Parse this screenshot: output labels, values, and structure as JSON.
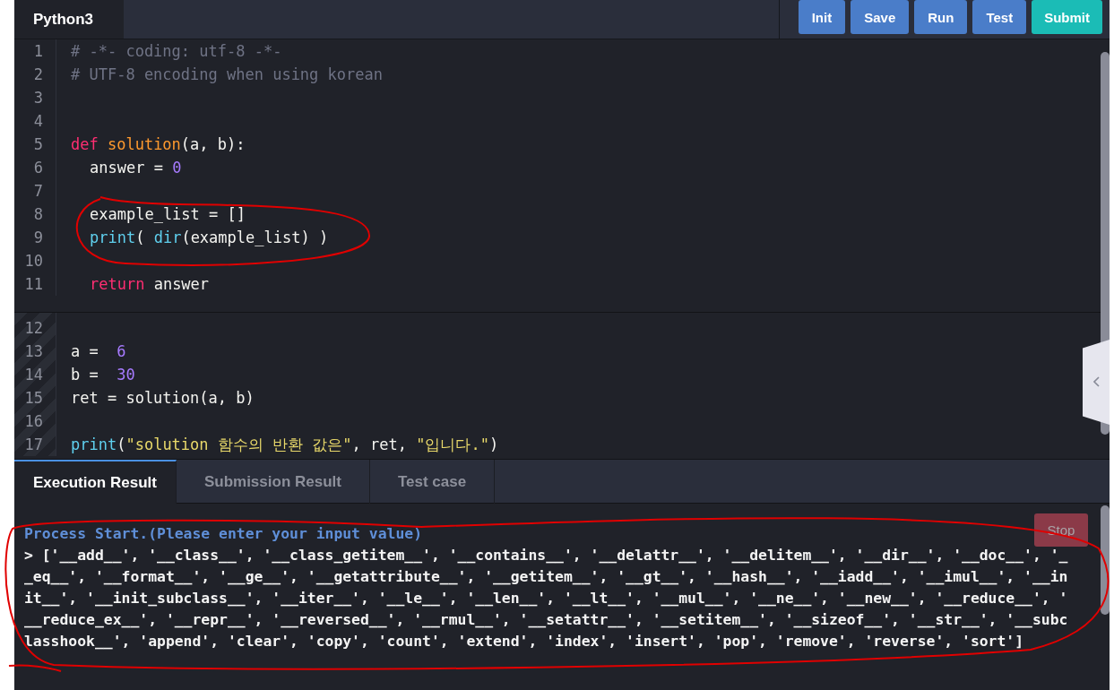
{
  "editor": {
    "language_tab": "Python3",
    "buttons": [
      {
        "label": "Init",
        "kind": "primary"
      },
      {
        "label": "Save",
        "kind": "primary"
      },
      {
        "label": "Run",
        "kind": "primary"
      },
      {
        "label": "Test",
        "kind": "primary"
      },
      {
        "label": "Submit",
        "kind": "accent"
      }
    ],
    "sections": [
      {
        "kind": "editable",
        "lines": [
          {
            "number": "1",
            "indent": false,
            "tokens": [
              {
                "kind": "comment",
                "text": "# -*- coding: utf-8 -*-"
              }
            ]
          },
          {
            "number": "2",
            "indent": false,
            "tokens": [
              {
                "kind": "comment",
                "text": "# UTF-8 encoding when using korean"
              }
            ]
          },
          {
            "number": "3"
          },
          {
            "number": "4"
          },
          {
            "number": "5",
            "indent": false,
            "tokens": [
              {
                "kind": "keyword",
                "text": "def "
              },
              {
                "kind": "function",
                "text": "solution"
              },
              {
                "kind": "plain",
                "text": "(a, b):"
              }
            ]
          },
          {
            "number": "6",
            "indent": true,
            "tokens": [
              {
                "kind": "plain",
                "text": "answer = "
              },
              {
                "kind": "number",
                "text": "0"
              }
            ]
          },
          {
            "number": "7"
          },
          {
            "number": "8",
            "indent": true,
            "tokens": [
              {
                "kind": "plain",
                "text": "example_list = []"
              }
            ]
          },
          {
            "number": "9",
            "indent": true,
            "tokens": [
              {
                "kind": "builtin",
                "text": "print"
              },
              {
                "kind": "plain",
                "text": "( "
              },
              {
                "kind": "builtin",
                "text": "dir"
              },
              {
                "kind": "plain",
                "text": "(example_list) )"
              }
            ]
          },
          {
            "number": "10"
          },
          {
            "number": "11",
            "indent": true,
            "tokens": [
              {
                "kind": "keyword",
                "text": "return"
              },
              {
                "kind": "plain",
                "text": " answer"
              }
            ]
          }
        ]
      },
      {
        "kind": "readonly",
        "lines": [
          {
            "number": "12"
          },
          {
            "number": "13",
            "indent": false,
            "tokens": [
              {
                "kind": "plain",
                "text": "a =  "
              },
              {
                "kind": "number",
                "text": "6"
              }
            ]
          },
          {
            "number": "14",
            "indent": false,
            "tokens": [
              {
                "kind": "plain",
                "text": "b =  "
              },
              {
                "kind": "number",
                "text": "30"
              }
            ]
          },
          {
            "number": "15",
            "indent": false,
            "tokens": [
              {
                "kind": "plain",
                "text": "ret = solution(a, b)"
              }
            ]
          },
          {
            "number": "16"
          },
          {
            "number": "17",
            "indent": false,
            "tokens": [
              {
                "kind": "builtin",
                "text": "print"
              },
              {
                "kind": "plain",
                "text": "("
              },
              {
                "kind": "string",
                "text": "\"solution 함수의 반환 값은\""
              },
              {
                "kind": "plain",
                "text": ", ret, "
              },
              {
                "kind": "string",
                "text": "\"입니다.\""
              },
              {
                "kind": "plain",
                "text": ")"
              }
            ]
          }
        ]
      }
    ]
  },
  "result_tabs": [
    {
      "label": "Execution Result",
      "selected": true
    },
    {
      "label": "Submission Result",
      "selected": false
    },
    {
      "label": "Test case",
      "selected": false
    }
  ],
  "console": {
    "stop_button": {
      "label": "Stop",
      "disabled": true
    },
    "lines": [
      {
        "kind": "info",
        "text": "Process Start.(Please enter your input value)"
      },
      {
        "kind": "output",
        "text": "> ['__add__', '__class__', '__class_getitem__', '__contains__', '__delattr__', '__delitem__', '__dir__', '__doc__', '_"
      },
      {
        "kind": "output",
        "text": "_eq__', '__format__', '__ge__', '__getattribute__', '__getitem__', '__gt__', '__hash__', '__iadd__', '__imul__', '__in"
      },
      {
        "kind": "output",
        "text": "it__', '__init_subclass__', '__iter__', '__le__', '__len__', '__lt__', '__mul__', '__ne__', '__new__', '__reduce__', '"
      },
      {
        "kind": "output",
        "text": "__reduce_ex__', '__repr__', '__reversed__', '__rmul__', '__setattr__', '__setitem__', '__sizeof__', '__str__', '__subc"
      },
      {
        "kind": "output",
        "text": "lasshook__', 'append', 'clear', 'copy', 'count', 'extend', 'index', 'insert', 'pop', 'remove', 'reverse', 'sort']"
      }
    ]
  },
  "annotations": [
    {
      "kind": "loop",
      "color": "#e00000"
    },
    {
      "kind": "loop",
      "color": "#e00000"
    }
  ]
}
